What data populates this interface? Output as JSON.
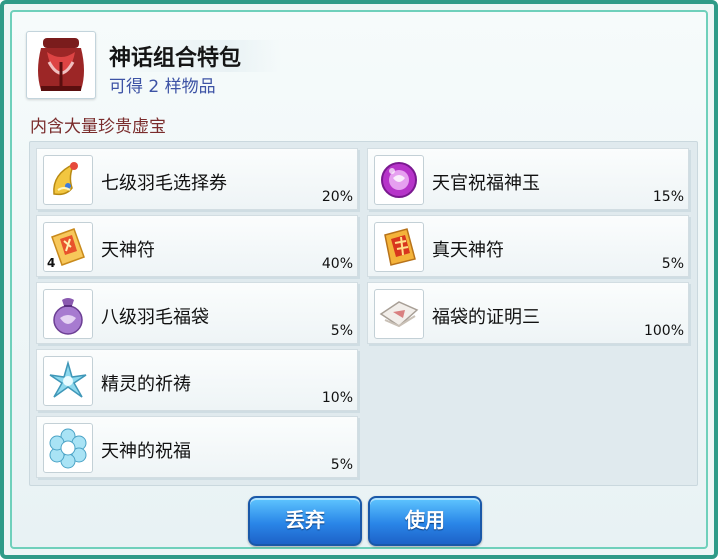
{
  "header": {
    "title": "神话组合特包",
    "subtitle": "可得 2 样物品",
    "icon": "red-bag-icon"
  },
  "description": "内含大量珍贵虚宝",
  "items": [
    {
      "name": "七级羽毛选择券",
      "rate": "20%",
      "icon": "golden-horn-icon"
    },
    {
      "name": "天官祝福神玉",
      "rate": "15%",
      "icon": "purple-orb-icon"
    },
    {
      "name": "天神符",
      "rate": "40%",
      "qty": "4",
      "icon": "talisman-scroll-icon"
    },
    {
      "name": "真天神符",
      "rate": "5%",
      "icon": "true-talisman-icon"
    },
    {
      "name": "八级羽毛福袋",
      "rate": "5%",
      "icon": "purple-pouch-icon"
    },
    {
      "name": "福袋的证明三",
      "rate": "100%",
      "icon": "paper-certificate-icon"
    },
    {
      "name": "精灵的祈祷",
      "rate": "10%",
      "icon": "ice-crystal-icon"
    },
    {
      "name": "天神的祝福",
      "rate": "5%",
      "icon": "ice-flower-icon"
    }
  ],
  "buttons": {
    "discard": "丢弃",
    "use": "使用"
  },
  "colors": {
    "frame": "#2f9b88",
    "button": "#2a86e8",
    "subtitle": "#3d53a5",
    "description": "#7a2c2c"
  }
}
